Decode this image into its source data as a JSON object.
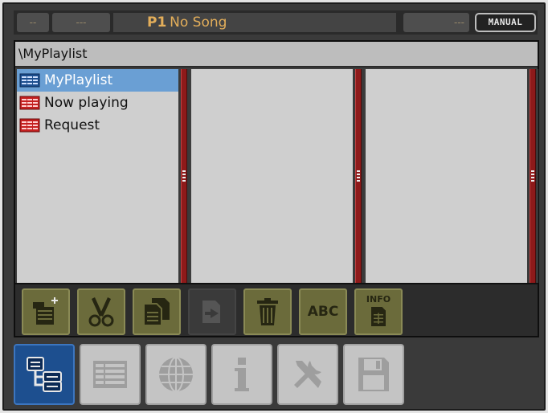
{
  "status": {
    "left_a": "--",
    "left_b": "---",
    "player": "P1",
    "song": "No Song",
    "right": "---",
    "mode_button": "MANUAL"
  },
  "browser": {
    "path": "\\MyPlaylist",
    "items": [
      {
        "label": "MyPlaylist",
        "selected": true,
        "icon": "playlist-icon"
      },
      {
        "label": "Now playing",
        "selected": false,
        "icon": "playlist-red-icon"
      },
      {
        "label": "Request",
        "selected": false,
        "icon": "playlist-red-icon"
      }
    ]
  },
  "actions": {
    "buttons": [
      {
        "name": "new-playlist-icon",
        "enabled": true
      },
      {
        "name": "cut-icon",
        "enabled": true
      },
      {
        "name": "copy-icon",
        "enabled": true
      },
      {
        "name": "paste-icon",
        "enabled": false
      },
      {
        "name": "trash-icon",
        "enabled": true
      },
      {
        "name": "rename-icon",
        "label": "ABC",
        "enabled": true
      },
      {
        "name": "info-icon",
        "label": "INFO",
        "enabled": true
      }
    ]
  },
  "nav": {
    "tabs": [
      {
        "name": "browser-icon",
        "active": true
      },
      {
        "name": "list-icon",
        "active": false
      },
      {
        "name": "globe-icon",
        "active": false
      },
      {
        "name": "about-icon",
        "active": false
      },
      {
        "name": "tools-icon",
        "active": false
      },
      {
        "name": "save-icon",
        "active": false
      }
    ]
  },
  "colors": {
    "accent": "#e3ae5a",
    "selection": "#6a9fd4",
    "divider": "#8e1a1a",
    "action_bg": "#6b6b3b",
    "nav_active": "#1d4f8f"
  }
}
